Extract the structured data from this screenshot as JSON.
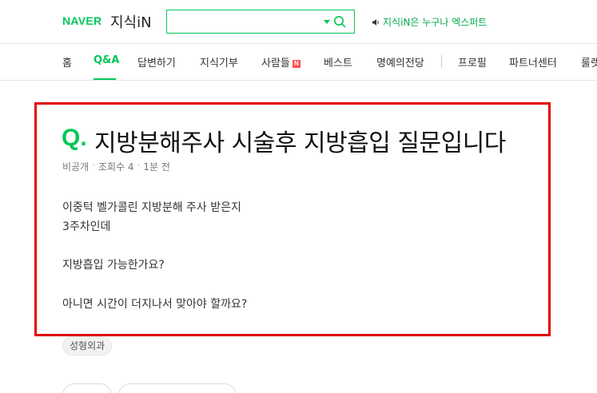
{
  "header": {
    "brand": "NAVER",
    "service": "지식iN",
    "search": {
      "value": "",
      "placeholder": ""
    },
    "notice": "지식iN은 누구나 엑스퍼트"
  },
  "tabs": [
    {
      "label": "홈",
      "active": false
    },
    {
      "label": "Q&A",
      "active": true
    },
    {
      "label": "답변하기",
      "active": false
    },
    {
      "label": "지식기부",
      "active": false
    },
    {
      "label": "사람들",
      "active": false,
      "badge": "N"
    },
    {
      "label": "베스트",
      "active": false
    },
    {
      "label": "명예의전당",
      "active": false
    },
    {
      "label": "프로필",
      "active": false
    },
    {
      "label": "파트너센터",
      "active": false
    },
    {
      "label": "룰렛",
      "active": false
    }
  ],
  "question": {
    "q_mark": "Q.",
    "title": "지방분해주사 시술후 지방흡입 질문입니다",
    "author": "비공개",
    "views": "조회수 4",
    "time": "1분 전",
    "body": [
      "이중턱 벨가콜린 지방분해 주사 받은지",
      "3주차인데",
      "지방흡입 가능한가요?",
      "아니면 시간이 더지나서 맞아야 할까요?"
    ],
    "tag": "성형외과"
  },
  "colors": {
    "accent": "#03c75a",
    "highlight": "#e00000"
  }
}
